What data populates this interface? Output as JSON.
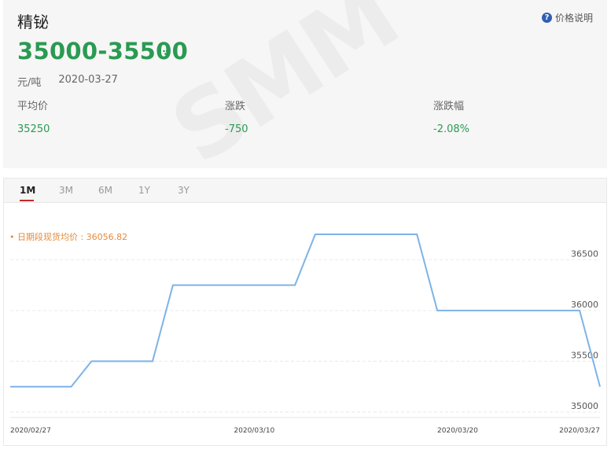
{
  "header": {
    "title": "精铋",
    "price_range": "35000-35500",
    "unit": "元/吨",
    "date": "2020-03-27",
    "help_label": "价格说明",
    "watermark": "SMM"
  },
  "stats": {
    "avg_label": "平均价",
    "avg_value": "35250",
    "change_label": "涨跌",
    "change_value": "-750",
    "pct_label": "涨跌幅",
    "pct_value": "-2.08%"
  },
  "colors": {
    "up_green": "#2a9a52",
    "line": "#7db3e6",
    "avg_label": "#e48a3c",
    "tab_active_underline": "#c62828"
  },
  "tabs": [
    {
      "label": "1M",
      "active": true
    },
    {
      "label": "3M",
      "active": false
    },
    {
      "label": "6M",
      "active": false
    },
    {
      "label": "1Y",
      "active": false
    },
    {
      "label": "3Y",
      "active": false
    }
  ],
  "chart_data": {
    "type": "line",
    "avg_label": "• 日期段现货均价 : 36056.82",
    "x_ticks": [
      "2020/02/27",
      "2020/03/10",
      "2020/03/20",
      "2020/03/27"
    ],
    "y_ticks": [
      35000,
      35500,
      36000,
      36500
    ],
    "ylim": [
      35000,
      36750
    ],
    "grid": "horizontal-dashed",
    "series": [
      {
        "x": [
          "2020-02-27",
          "2020-03-01",
          "2020-03-02",
          "2020-03-03",
          "2020-03-05",
          "2020-03-06",
          "2020-03-12",
          "2020-03-13",
          "2020-03-18",
          "2020-03-19",
          "2020-03-25",
          "2020-03-26",
          "2020-03-27"
        ],
        "values": [
          35250,
          35250,
          35500,
          35500,
          35500,
          36250,
          36250,
          36750,
          36750,
          36000,
          36000,
          36000,
          35250
        ]
      }
    ]
  }
}
